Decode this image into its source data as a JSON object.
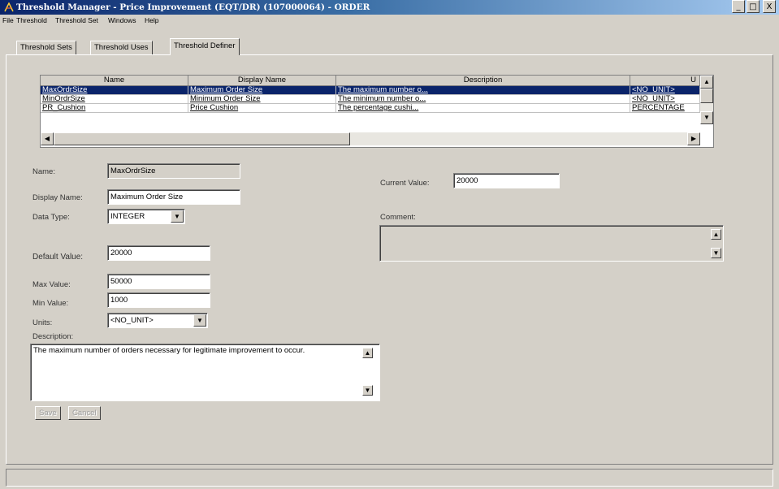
{
  "window": {
    "title": "Threshold Manager - Price Improvement (EQT/DR) (107000064) - ORDER",
    "minimize": "_",
    "maximize": "□",
    "close": "X"
  },
  "menu": [
    "File",
    "Threshold",
    "Threshold Set",
    "Windows",
    "Help"
  ],
  "tabs": [
    "Threshold Sets",
    "Threshold Uses",
    "Threshold Definer"
  ],
  "grid": {
    "headers": [
      "Name",
      "Display Name",
      "Description",
      "U"
    ],
    "rows": [
      [
        "MaxOrdrSize",
        "Maximum Order Size",
        "The maximum number o...",
        "<NO_UNIT>"
      ],
      [
        "MinOrdrSize",
        "Minimum Order Size",
        "The minimum number o...",
        "<NO_UNIT>"
      ],
      [
        "PR_Cushion",
        "Price Cushion",
        "The percentage cushi...",
        "PERCENTAGE"
      ]
    ]
  },
  "form": {
    "name_label": "Name:",
    "name_value": "MaxOrdrSize",
    "display_name_label": "Display Name:",
    "display_name_value": "Maximum Order Size",
    "data_type_label": "Data Type:",
    "data_type_value": "INTEGER",
    "default_value_label": "Default Value:",
    "default_value": "20000",
    "max_value_label": "Max Value:",
    "max_value": "50000",
    "min_value_label": "Min Value:",
    "min_value": "1000",
    "units_label": "Units:",
    "units_value": "<NO_UNIT>",
    "description_label": "Description:",
    "description_value": "The maximum number of orders necessary for legitimate improvement to occur.",
    "current_value_label": "Current Value:",
    "current_value": "20000",
    "comment_label": "Comment:",
    "comment_value": "",
    "save_label": "Save",
    "cancel_label": "Cancel"
  },
  "colors": {
    "title_gradient_start": "#0a246a",
    "title_gradient_end": "#a6caf0",
    "selection": "#0a246a",
    "window_bg": "#d4d0c8"
  }
}
